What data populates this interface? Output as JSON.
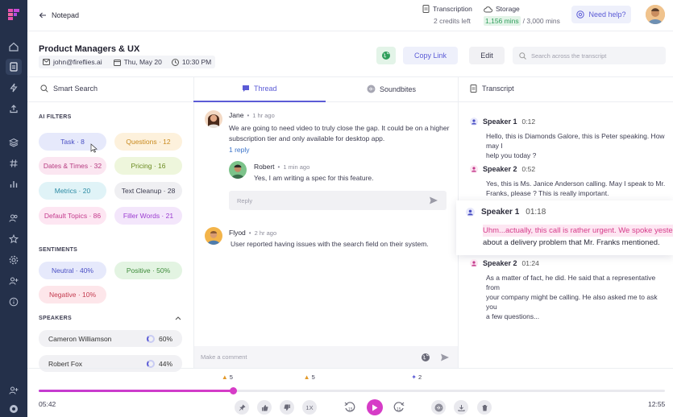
{
  "header": {
    "back_label": "Notepad",
    "transcription_label": "Transcription",
    "transcription_sub": "2 credits left",
    "storage_label": "Storage",
    "storage_used": "1,156 mins",
    "storage_total": "/ 3,000 mins",
    "help_label": "Need help?"
  },
  "meeting": {
    "title": "Product Managers & UX",
    "email": "john@fireflies.ai",
    "date": "Thu, May 20",
    "time": "10:30 PM",
    "copy_link": "Copy Link",
    "edit": "Edit",
    "search_placeholder": "Search across the transcript"
  },
  "left": {
    "smart_search": "Smart Search",
    "ai_filters_title": "AI FILTERS",
    "filters": [
      {
        "label": "Task · 8"
      },
      {
        "label": "Questions · 12"
      },
      {
        "label": "Dates & Times · 32"
      },
      {
        "label": "Pricing · 16"
      },
      {
        "label": "Metrics · 20"
      },
      {
        "label": "Text Cleanup · 28"
      },
      {
        "label": "Default Topics · 86"
      },
      {
        "label": "Filler Words · 21"
      }
    ],
    "sentiments_title": "SENTIMENTS",
    "sentiments": [
      {
        "label": "Neutral · 40%"
      },
      {
        "label": "Positive · 50%"
      },
      {
        "label": "Negative · 10%"
      }
    ],
    "speakers_title": "SPEAKERS",
    "speakers": [
      {
        "name": "Cameron Williamson",
        "pct": "60%",
        "share": 0.6
      },
      {
        "name": "Robert Fox",
        "pct": "44%",
        "share": 0.44
      }
    ]
  },
  "middle": {
    "tab_thread": "Thread",
    "tab_soundbites": "Soundbites",
    "comments": [
      {
        "name": "Jane",
        "time": "1 hr ago",
        "text1": "We are going to need video to truly close the gap. It could be on a higher",
        "text2": "subscription tier and only available for desktop app.",
        "replies": "1 reply"
      },
      {
        "name": "Robert",
        "time": "1 min ago",
        "text1": "Yes, I am writing a spec for this feature."
      },
      {
        "name": "Flyod",
        "time": "2 hr ago",
        "text1": "User reported having issues with the search field on their system."
      }
    ],
    "reply_placeholder": "Reply",
    "comment_placeholder": "Make a comment"
  },
  "transcript": {
    "title": "Transcript",
    "entries": [
      {
        "speaker": "Speaker 1",
        "time": "0:12",
        "line1": "Hello, this is Diamonds Galore, this is Peter speaking. How may I",
        "line2": "help you today ?"
      },
      {
        "speaker": "Speaker 2",
        "time": "0:52",
        "line1": "Yes, this is Ms. Janice Anderson calling. May I speak to Mr.",
        "line2": "Franks, please ? This is really important."
      },
      {
        "speaker": "Speaker 1",
        "time": "01:18",
        "line1": "Uhm...actually, this call is rather urgent. We spoke yesterday",
        "line2": "about a delivery problem that Mr. Franks mentioned."
      },
      {
        "speaker": "Speaker 2",
        "time": "01:24",
        "line1": "As a matter of fact, he did. He said that a representative from",
        "line2": "your company might be calling. He also asked me to ask you",
        "line3": "a few questions..."
      }
    ]
  },
  "player": {
    "current": "05:42",
    "total": "12:55",
    "progress": 0.31,
    "speed": "1X",
    "markers": [
      {
        "label": "5",
        "icon": "thumbs-up-icon",
        "pos": 0.31
      },
      {
        "label": "5",
        "icon": "thumbs-up-icon",
        "pos": 0.441
      },
      {
        "label": "2",
        "icon": "pin-icon",
        "pos": 0.613
      }
    ]
  },
  "colors": {
    "accent": "#5b5bd6",
    "brand_magenta": "#d63cc7",
    "rail": "#24304a",
    "storage_green": "#2e9e5b"
  }
}
